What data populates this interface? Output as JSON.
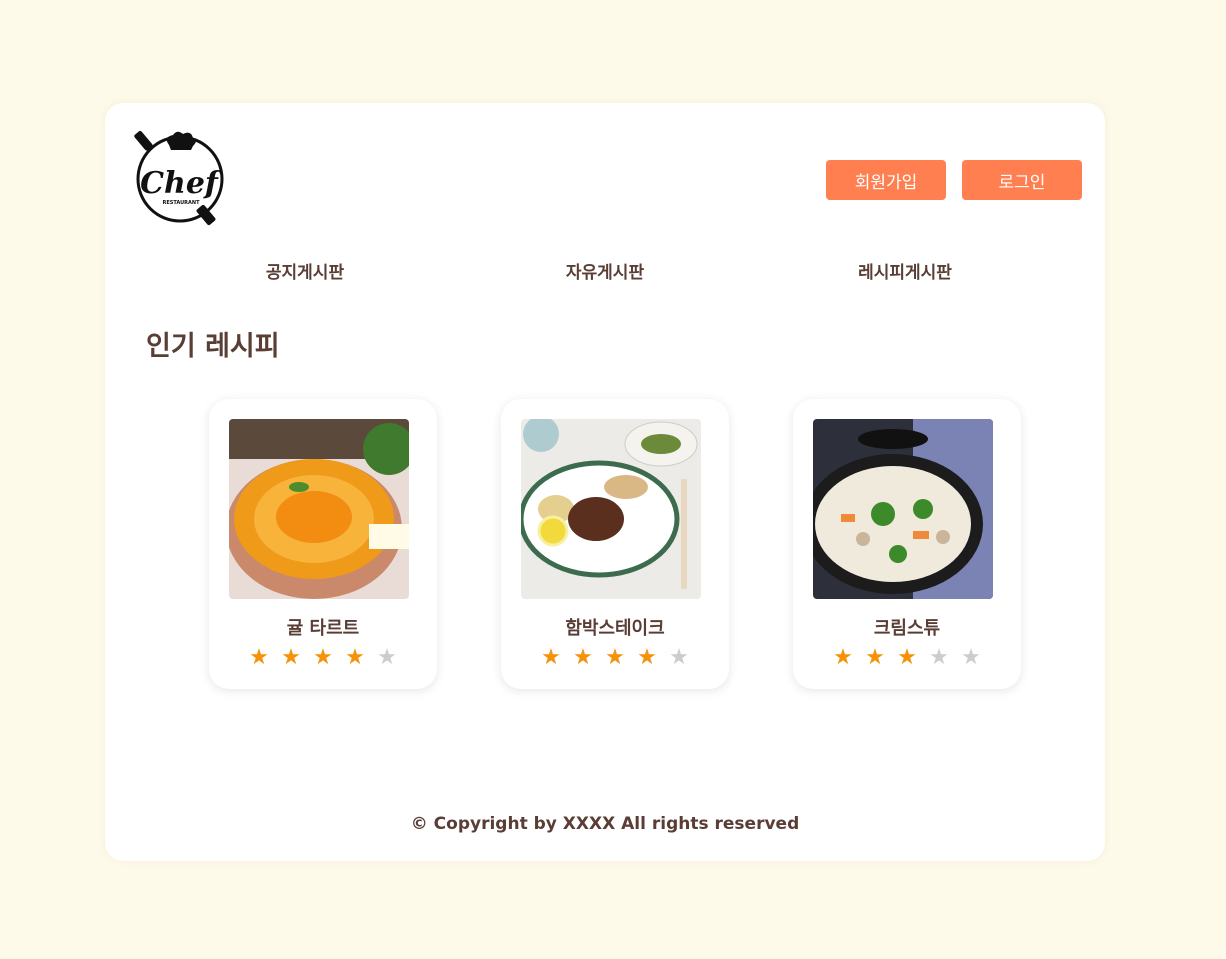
{
  "header": {
    "logo": {
      "main_text": "Chef",
      "sub_text": "RESTAURANT",
      "icon": "chef-hat-logo-icon"
    },
    "signup_label": "회원가입",
    "login_label": "로그인",
    "button_color": "#ff7f50"
  },
  "nav": {
    "items": [
      {
        "label": "공지게시판"
      },
      {
        "label": "자유게시판"
      },
      {
        "label": "레시피게시판"
      }
    ]
  },
  "main": {
    "section_title": "인기 레시피",
    "recipes": [
      {
        "name": "귤 타르트",
        "rating": 4,
        "max_rating": 5,
        "image": "orange-tart-image"
      },
      {
        "name": "함박스테이크",
        "rating": 4,
        "max_rating": 5,
        "image": "hamburg-steak-image"
      },
      {
        "name": "크림스튜",
        "rating": 3,
        "max_rating": 5,
        "image": "cream-stew-image"
      }
    ],
    "star_filled_color": "#f5920a",
    "star_empty_color": "#cccccc"
  },
  "footer": {
    "copyright": "© Copyright by XXXX All rights reserved"
  },
  "colors": {
    "page_bg": "#fefaea",
    "card_bg": "#ffffff",
    "text": "#5a3e36"
  }
}
